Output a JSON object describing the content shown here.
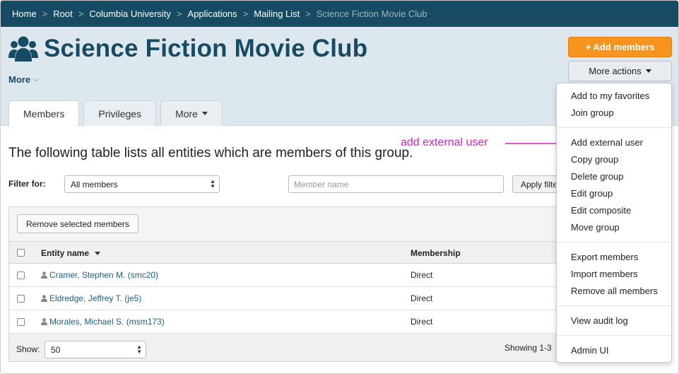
{
  "breadcrumb": {
    "items": [
      "Home",
      "Root",
      "Columbia University",
      "Applications",
      "Mailing List"
    ],
    "current": "Science Fiction Movie Club"
  },
  "header": {
    "title": "Science Fiction Movie Club",
    "more_label": "More",
    "add_members_label": "+ Add members",
    "more_actions_label": "More actions"
  },
  "tabs": [
    {
      "label": "Members",
      "active": true
    },
    {
      "label": "Privileges",
      "active": false
    },
    {
      "label": "More",
      "active": false
    }
  ],
  "main": {
    "intro": "The following table lists all entities which are members of this group.",
    "filter_label": "Filter for:",
    "filter_value": "All members",
    "member_name_placeholder": "Member name",
    "apply_filter_label": "Apply filter",
    "remove_selected_label": "Remove selected members"
  },
  "table": {
    "columns": [
      "Entity name",
      "Membership"
    ],
    "rows": [
      {
        "name": "Cramer, Stephen M. (smc20)",
        "membership": "Direct"
      },
      {
        "name": "Eldredge, Jeffrey T. (je5)",
        "membership": "Direct"
      },
      {
        "name": "Morales, Michael S. (msm173)",
        "membership": "Direct"
      }
    ],
    "show_label": "Show:",
    "page_size": "50",
    "showing_text": "Showing 1-3"
  },
  "menu": {
    "items": [
      "Add to my favorites",
      "Join group",
      "Add external user",
      "Copy group",
      "Delete group",
      "Edit group",
      "Edit composite",
      "Move group",
      "Export members",
      "Import members",
      "Remove all members",
      "View audit log",
      "Admin UI"
    ]
  },
  "annotation": {
    "text": "add external user"
  },
  "colors": {
    "brand_navy": "#174a63",
    "accent_orange": "#f7941d",
    "link_blue": "#1a5f86",
    "annotation_magenta": "#d81fc9"
  }
}
